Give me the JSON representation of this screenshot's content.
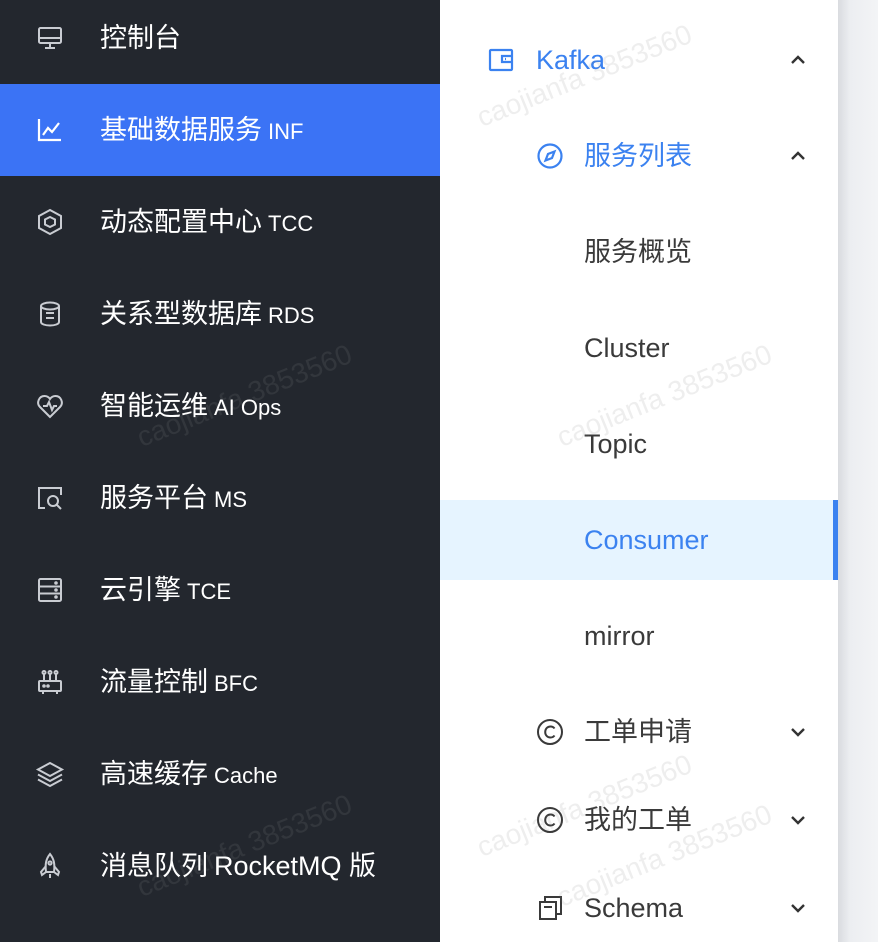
{
  "sidebar": {
    "items": [
      {
        "zh": "控制台",
        "en": "",
        "icon": "monitor-icon"
      },
      {
        "zh": "基础数据服务",
        "en": "INF",
        "icon": "line-chart-icon",
        "active": true
      },
      {
        "zh": "动态配置中心",
        "en": "TCC",
        "icon": "hexagon-icon"
      },
      {
        "zh": "关系型数据库",
        "en": "RDS",
        "icon": "database-icon"
      },
      {
        "zh": "智能运维",
        "en": "AI Ops",
        "icon": "heart-pulse-icon"
      },
      {
        "zh": "服务平台",
        "en": "MS",
        "icon": "search-window-icon"
      },
      {
        "zh": "云引擎",
        "en": "TCE",
        "icon": "server-icon"
      },
      {
        "zh": "流量控制",
        "en": "BFC",
        "icon": "router-icon"
      },
      {
        "zh": "高速缓存",
        "en": "Cache",
        "icon": "layers-icon"
      },
      {
        "zh": "消息队列",
        "en": "RocketMQ 版",
        "icon": "rocket-icon"
      }
    ]
  },
  "submenu": {
    "group_title": "Kafka",
    "group_icon": "wallet-icon",
    "subgroup_title": "服务列表",
    "subgroup_icon": "compass-icon",
    "items": [
      {
        "label": "服务概览"
      },
      {
        "label": "Cluster"
      },
      {
        "label": "Topic"
      },
      {
        "label": "Consumer",
        "selected": true
      },
      {
        "label": "mirror"
      }
    ],
    "collapsed_groups": [
      {
        "label": "工单申请",
        "icon": "copyright-icon"
      },
      {
        "label": "我的工单",
        "icon": "copyright-icon"
      },
      {
        "label": "Schema",
        "icon": "copy-icon"
      }
    ]
  },
  "watermark": "caojianfa 3853560",
  "colors": {
    "sidebar_bg": "#23272e",
    "active_bg": "#3b73f5",
    "accent": "#3b82f0",
    "selected_bg": "#e6f4ff"
  }
}
